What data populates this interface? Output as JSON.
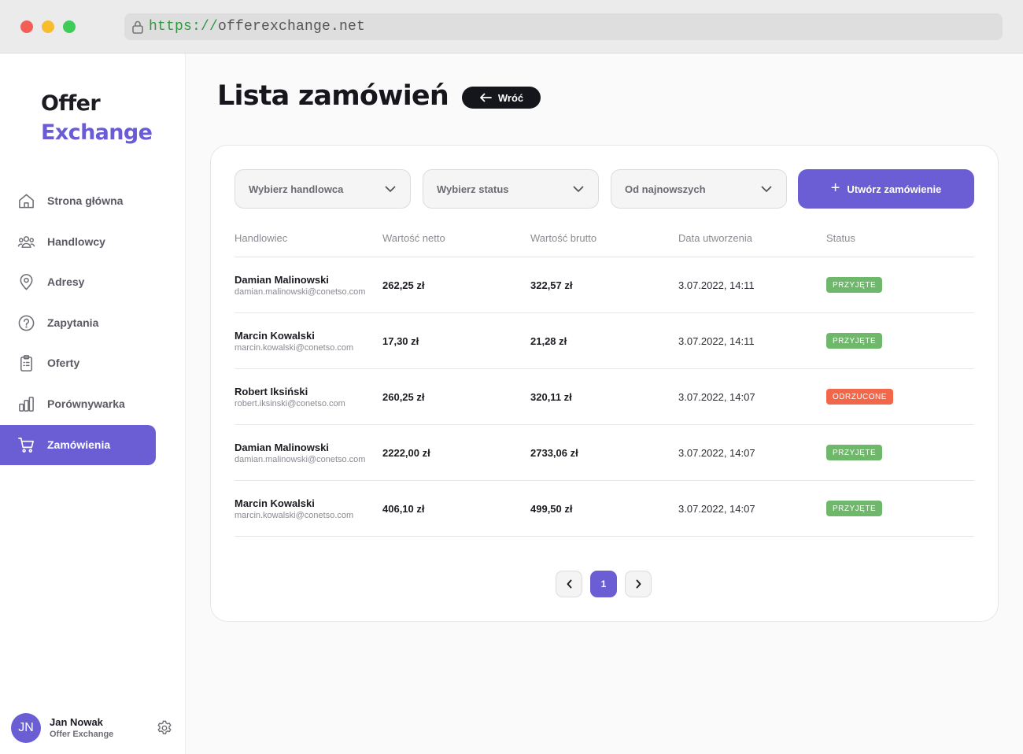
{
  "browser": {
    "protocol": "https://",
    "host": "offerexchange.net"
  },
  "logo": {
    "line1": "Offer",
    "line2": "Exchange"
  },
  "nav": [
    {
      "label": "Strona główna",
      "icon": "home-icon",
      "active": false
    },
    {
      "label": "Handlowcy",
      "icon": "users-icon",
      "active": false
    },
    {
      "label": "Adresy",
      "icon": "location-pin-icon",
      "active": false
    },
    {
      "label": "Zapytania",
      "icon": "question-icon",
      "active": false
    },
    {
      "label": "Oferty",
      "icon": "clipboard-icon",
      "active": false
    },
    {
      "label": "Porównywarka",
      "icon": "bar-chart-icon",
      "active": false
    },
    {
      "label": "Zamówienia",
      "icon": "cart-icon",
      "active": true
    }
  ],
  "user": {
    "initials": "JN",
    "name": "Jan Nowak",
    "organization": "Offer Exchange"
  },
  "page": {
    "title": "Lista zamówień",
    "back_label": "Wróć"
  },
  "filters": {
    "salesperson": "Wybierz handlowca",
    "status": "Wybierz status",
    "sort": "Od najnowszych",
    "create_label": "Utwórz zamówienie"
  },
  "table": {
    "headers": [
      "Handlowiec",
      "Wartość netto",
      "Wartość brutto",
      "Data utworzenia",
      "Status"
    ],
    "rows": [
      {
        "name": "Damian Malinowski",
        "email": "damian.malinowski@conetso.com",
        "net": "262,25 zł",
        "gross": "322,57 zł",
        "date": "3.07.2022, 14:11",
        "status": "PRZYJĘTE"
      },
      {
        "name": "Marcin Kowalski",
        "email": "marcin.kowalski@conetso.com",
        "net": "17,30 zł",
        "gross": "21,28 zł",
        "date": "3.07.2022, 14:11",
        "status": "PRZYJĘTE"
      },
      {
        "name": "Robert Iksiński",
        "email": "robert.iksinski@conetso.com",
        "net": "260,25 zł",
        "gross": "320,11 zł",
        "date": "3.07.2022, 14:07",
        "status": "ODRZUCONE"
      },
      {
        "name": "Damian Malinowski",
        "email": "damian.malinowski@conetso.com",
        "net": "2222,00 zł",
        "gross": "2733,06 zł",
        "date": "3.07.2022, 14:07",
        "status": "PRZYJĘTE"
      },
      {
        "name": "Marcin Kowalski",
        "email": "marcin.kowalski@conetso.com",
        "net": "406,10 zł",
        "gross": "499,50 zł",
        "date": "3.07.2022, 14:07",
        "status": "PRZYJĘTE"
      }
    ]
  },
  "status_colors": {
    "PRZYJĘTE": "#6fb86b",
    "ODRZUCONE": "#f2664a"
  },
  "pagination": {
    "current_page": "1"
  },
  "colors": {
    "accent": "#6b5dd3"
  }
}
